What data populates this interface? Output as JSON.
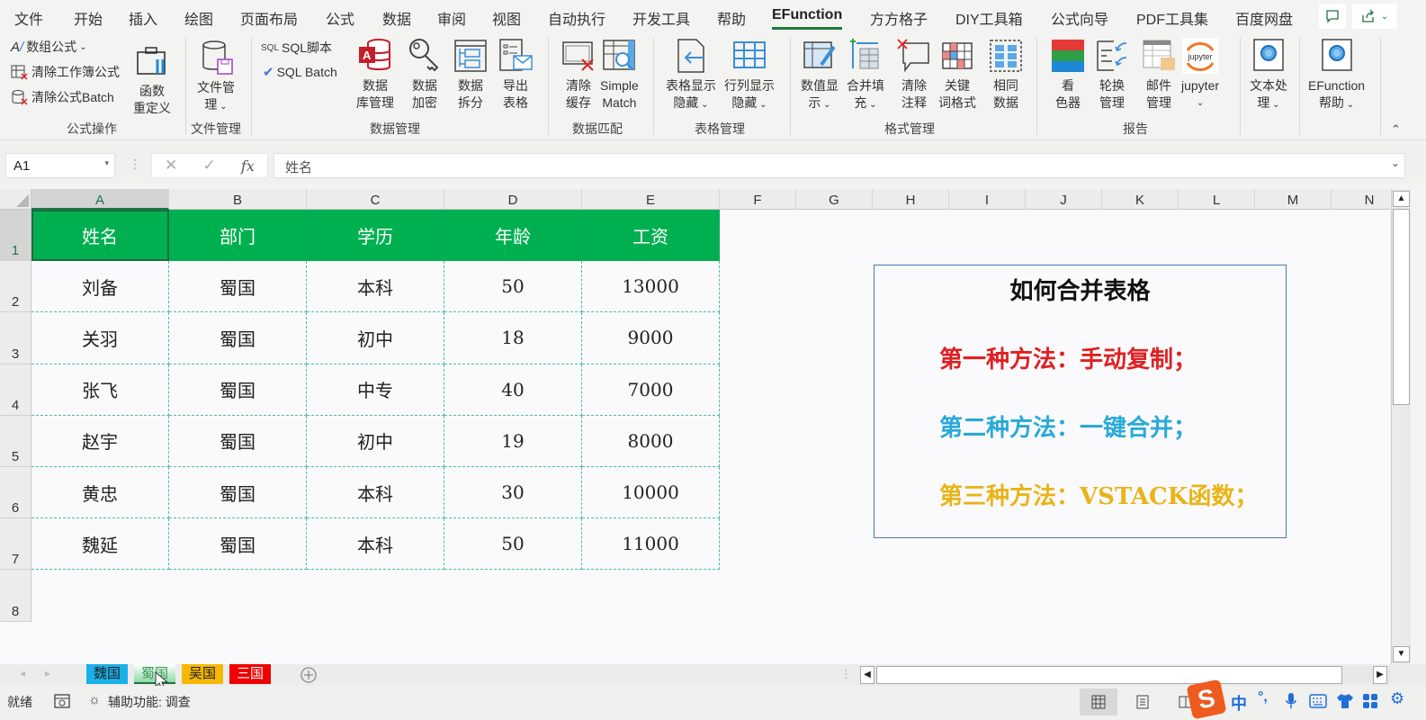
{
  "menu_tabs": [
    "文件",
    "开始",
    "插入",
    "绘图",
    "页面布局",
    "公式",
    "数据",
    "审阅",
    "视图",
    "自动执行",
    "开发工具",
    "帮助",
    "EFunction",
    "方方格子",
    "DIY工具箱",
    "公式向导",
    "PDF工具集",
    "百度网盘"
  ],
  "active_tab": "EFunction",
  "ribbon": {
    "formula_ops": {
      "array_formula": "数组公式",
      "clear_workbook_formula": "清除工作簿公式",
      "clear_formula_batch": "清除公式Batch",
      "func_redefine_1": "函数",
      "func_redefine_2": "重定义",
      "group_label": "公式操作"
    },
    "file_mgmt": {
      "btn_1": "文件管",
      "btn_2": "理",
      "group_label": "文件管理"
    },
    "data_mgmt": {
      "sql_script": "SQL脚本",
      "sql_batch": "SQL Batch",
      "sql_tag": "SQL",
      "db_1": "数据",
      "db_2": "库管理",
      "enc_1": "数据",
      "enc_2": "加密",
      "split_1": "数据",
      "split_2": "拆分",
      "export_1": "导出",
      "export_2": "表格",
      "group_label": "数据管理"
    },
    "data_match": {
      "clear_cache_1": "清除",
      "clear_cache_2": "缓存",
      "simple_1": "Simple",
      "simple_2": "Match",
      "group_label": "数据匹配"
    },
    "table_mgmt": {
      "table_show_1": "表格显示",
      "table_show_2": "隐藏",
      "rowcol_show_1": "行列显示",
      "rowcol_show_2": "隐藏",
      "group_label": "表格管理"
    },
    "format_mgmt": {
      "num_1": "数值显",
      "num_2": "示",
      "merge_1": "合并填",
      "merge_2": "充",
      "clear_note_1": "清除",
      "clear_note_2": "注释",
      "kw_1": "关键",
      "kw_2": "词格式",
      "same_1": "相同",
      "same_2": "数据",
      "group_label": "格式管理"
    },
    "report": {
      "color_1": "看",
      "color_2": "色器",
      "rotate_1": "轮换",
      "rotate_2": "管理",
      "mail_1": "邮件",
      "mail_2": "管理",
      "jupyter": "jupyter",
      "jupyter_logo": "jupyter",
      "group_label": "报告"
    },
    "text_proc_1": "文本处",
    "text_proc_2": "理",
    "ef_help_1": "EFunction",
    "ef_help_2": "帮助"
  },
  "formula_bar": {
    "name_box": "A1",
    "fx": "fx",
    "value": "姓名"
  },
  "columns": [
    "A",
    "B",
    "C",
    "D",
    "E",
    "F",
    "G",
    "H",
    "I",
    "J",
    "K",
    "L",
    "M",
    "N"
  ],
  "rows": [
    "1",
    "2",
    "3",
    "4",
    "5",
    "6",
    "7",
    "8"
  ],
  "table": {
    "headers": [
      "姓名",
      "部门",
      "学历",
      "年龄",
      "工资"
    ],
    "rows": [
      [
        "刘备",
        "蜀国",
        "本科",
        "50",
        "13000"
      ],
      [
        "关羽",
        "蜀国",
        "初中",
        "18",
        "9000"
      ],
      [
        "张飞",
        "蜀国",
        "中专",
        "40",
        "7000"
      ],
      [
        "赵宇",
        "蜀国",
        "初中",
        "19",
        "8000"
      ],
      [
        "黄忠",
        "蜀国",
        "本科",
        "30",
        "10000"
      ],
      [
        "魏延",
        "蜀国",
        "本科",
        "50",
        "11000"
      ]
    ]
  },
  "note_box": {
    "title": "如何合并表格",
    "lines": [
      {
        "text": "第一种方法：手动复制；",
        "color": "#e02020"
      },
      {
        "text": "第二种方法：一键合并；",
        "color": "#29a9d8"
      },
      {
        "text": "第三种方法：VSTACK函数；",
        "color": "#e8b418"
      }
    ]
  },
  "sheets": [
    {
      "name": "魏国",
      "color": "#1ab0e8"
    },
    {
      "name": "蜀国",
      "color": "#8fd9a8"
    },
    {
      "name": "吴国",
      "color": "#f5b800"
    },
    {
      "name": "三国",
      "color": "#f00000"
    }
  ],
  "active_sheet": "蜀国",
  "status": {
    "ready": "就绪",
    "accessibility": "辅助功能: 调查"
  },
  "ime": {
    "lang": "中",
    "punct": "°,"
  },
  "colors": {
    "header_green": "#00b050",
    "accent": "#217346"
  }
}
